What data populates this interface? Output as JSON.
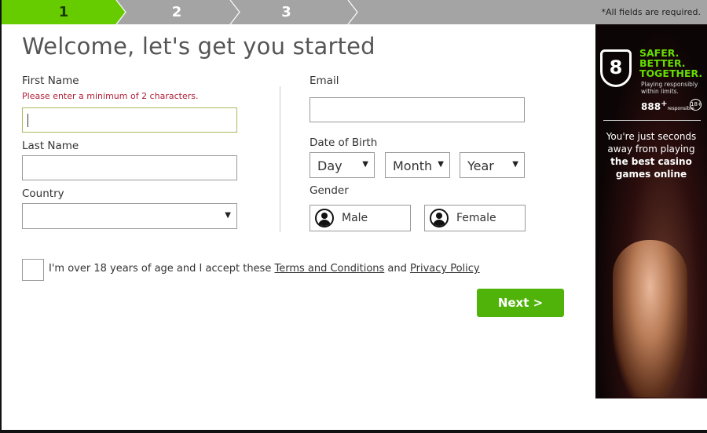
{
  "steps": {
    "items": [
      "1",
      "2",
      "3"
    ],
    "active": 1,
    "required_note": "*All fields are required."
  },
  "title": "Welcome, let's get you started",
  "form": {
    "first_name": {
      "label": "First Name",
      "error": "Please enter a minimum of 2 characters.",
      "value": ""
    },
    "last_name": {
      "label": "Last Name",
      "value": ""
    },
    "country": {
      "label": "Country",
      "value": ""
    },
    "email": {
      "label": "Email",
      "value": ""
    },
    "dob": {
      "label": "Date of Birth",
      "day": "Day",
      "month": "Month",
      "year": "Year"
    },
    "gender": {
      "label": "Gender",
      "male": "Male",
      "female": "Female"
    },
    "terms": {
      "prefix": "I'm over 18 years of age and I accept these ",
      "terms_link": "Terms and Conditions",
      "and": " and ",
      "privacy_link": "Privacy Policy",
      "checked": false
    },
    "next_label": "Next >"
  },
  "ad": {
    "logo": "8",
    "headline": [
      "SAFER.",
      "BETTER.",
      "TOGETHER."
    ],
    "sub": "Playing responsibly within limits.",
    "brand": "888",
    "brand_sup": "+",
    "brand_small": "responsible",
    "age_badge": "18+",
    "text": [
      "You're just seconds",
      "away from playing",
      "the best casino",
      "games online"
    ]
  },
  "colors": {
    "accent": "#66cc00",
    "button": "#4fb30a",
    "error": "#b0203a",
    "step_bar": "#a4a4a4"
  }
}
